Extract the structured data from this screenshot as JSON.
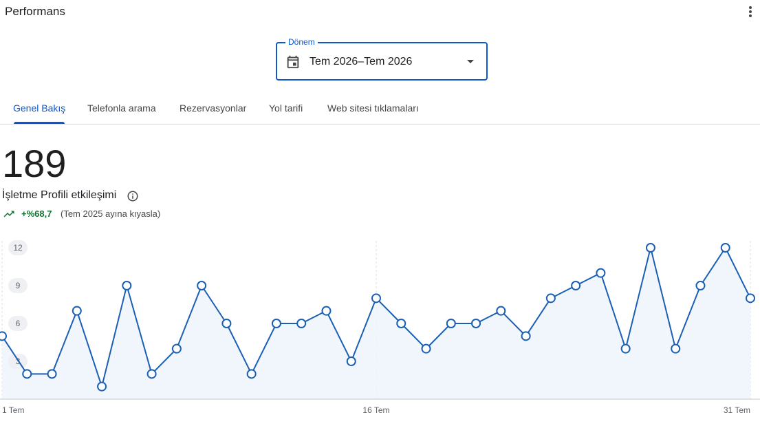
{
  "header": {
    "title": "Performans"
  },
  "period": {
    "legend": "Dönem",
    "value": "Tem 2026–Tem 2026"
  },
  "tabs": [
    {
      "label": "Genel Bakış",
      "active": true
    },
    {
      "label": "Telefonla arama",
      "active": false
    },
    {
      "label": "Rezervasyonlar",
      "active": false
    },
    {
      "label": "Yol tarifi",
      "active": false
    },
    {
      "label": "Web sitesi tıklamaları",
      "active": false
    }
  ],
  "summary": {
    "total": "189",
    "label": "İşletme Profili etkileşimi",
    "change": "+%68,7",
    "comparison": "(Tem 2025 ayına kıyasla)"
  },
  "colors": {
    "accent": "#0b57d0",
    "line": "#1a5fb4",
    "positive": "#137333"
  },
  "icons": {
    "menu": "more-vert-icon",
    "period": "calendar-icon",
    "dropdown": "caret-down-icon",
    "info": "info-icon",
    "trend": "trending-up-icon"
  },
  "chart_data": {
    "type": "line",
    "x": [
      "1 Tem",
      "2 Tem",
      "3 Tem",
      "4 Tem",
      "5 Tem",
      "6 Tem",
      "7 Tem",
      "8 Tem",
      "9 Tem",
      "10 Tem",
      "11 Tem",
      "12 Tem",
      "13 Tem",
      "14 Tem",
      "15 Tem",
      "16 Tem",
      "17 Tem",
      "18 Tem",
      "19 Tem",
      "20 Tem",
      "21 Tem",
      "22 Tem",
      "23 Tem",
      "24 Tem",
      "25 Tem",
      "26 Tem",
      "27 Tem",
      "28 Tem",
      "29 Tem",
      "30 Tem",
      "31 Tem"
    ],
    "values": [
      5,
      2,
      2,
      7,
      1,
      9,
      2,
      4,
      9,
      6,
      2,
      6,
      6,
      7,
      3,
      8,
      6,
      4,
      6,
      6,
      7,
      5,
      8,
      9,
      10,
      4,
      12,
      4,
      9,
      12,
      8
    ],
    "x_tick_labels": [
      "1 Tem",
      "16 Tem",
      "31 Tem"
    ],
    "y_ticks": [
      3,
      6,
      9,
      12
    ],
    "ylim": [
      0,
      12
    ],
    "grid": false
  }
}
